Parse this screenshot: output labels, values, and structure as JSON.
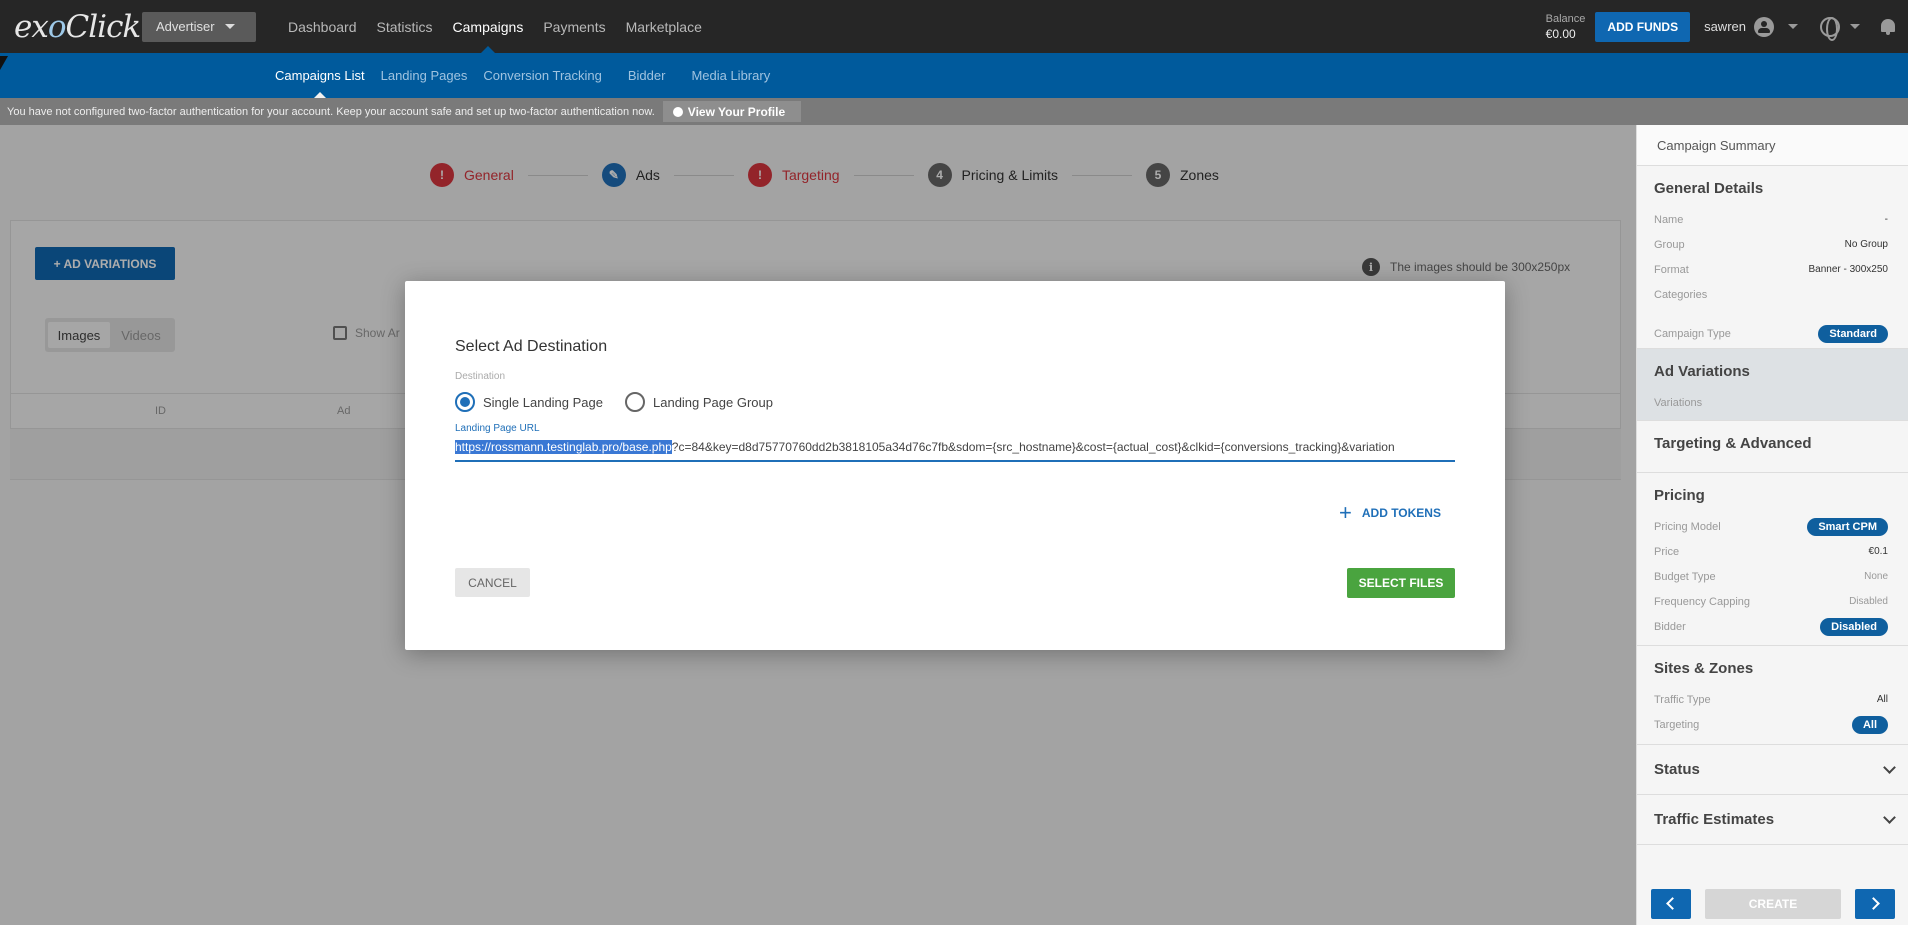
{
  "header": {
    "logo": "exoClick",
    "advertiser_label": "Advertiser",
    "nav": [
      "Dashboard",
      "Statistics",
      "Campaigns",
      "Payments",
      "Marketplace"
    ],
    "active_nav": "Campaigns",
    "balance_label": "Balance",
    "balance_value": "€0.00",
    "add_funds": "ADD FUNDS",
    "username": "sawren"
  },
  "subnav": {
    "items": [
      "Campaigns List",
      "Landing Pages",
      "Conversion Tracking",
      "Bidder",
      "Media Library"
    ],
    "active": "Campaigns List"
  },
  "banner": {
    "text": "You have not configured two-factor authentication for your account. Keep your account safe and set up two-factor authentication now.",
    "button": "View Your Profile"
  },
  "stepper": {
    "steps": [
      {
        "marker": "!",
        "label": "General",
        "state": "error"
      },
      {
        "marker": "✎",
        "label": "Ads",
        "state": "edit"
      },
      {
        "marker": "!",
        "label": "Targeting",
        "state": "error"
      },
      {
        "marker": "4",
        "label": "Pricing & Limits",
        "state": "pending"
      },
      {
        "marker": "5",
        "label": "Zones",
        "state": "pending"
      }
    ]
  },
  "ads": {
    "add_variations": "+ AD VARIATIONS",
    "image_note": "The images should be 300x250px",
    "toggle": [
      "Images",
      "Videos"
    ],
    "toggle_active": "Images",
    "show_checkbox": "Show Ar",
    "columns": [
      "ID",
      "Ad"
    ]
  },
  "modal": {
    "title": "Select Ad Destination",
    "destination_label": "Destination",
    "options": [
      "Single Landing Page",
      "Landing Page Group"
    ],
    "selected_option": "Single Landing Page",
    "url_label": "Landing Page URL",
    "url_selected": "https://rossmann.testinglab.pro/base.php",
    "url_rest": "?c=84&key=d8d75770760dd2b3818105a34d76c7fb&sdom={src_hostname}&cost={actual_cost}&clkid={conversions_tracking}&variation",
    "add_tokens": "ADD TOKENS",
    "cancel": "CANCEL",
    "select_files": "SELECT FILES"
  },
  "summary": {
    "header": "Campaign Summary",
    "general": {
      "title": "General Details",
      "name_label": "Name",
      "name_value": "-",
      "group_label": "Group",
      "group_value": "No Group",
      "format_label": "Format",
      "format_value": "Banner - 300x250",
      "categories_label": "Categories",
      "type_label": "Campaign Type",
      "type_value": "Standard"
    },
    "ad_variations": {
      "title": "Ad Variations",
      "variations_label": "Variations"
    },
    "targeting_title": "Targeting & Advanced",
    "pricing": {
      "title": "Pricing",
      "model_label": "Pricing Model",
      "model_value": "Smart CPM",
      "price_label": "Price",
      "price_value": "€0.1",
      "budget_label": "Budget Type",
      "budget_value": "None",
      "freq_label": "Frequency Capping",
      "freq_value": "Disabled",
      "bidder_label": "Bidder",
      "bidder_value": "Disabled"
    },
    "sites": {
      "title": "Sites & Zones",
      "traffic_label": "Traffic Type",
      "traffic_value": "All",
      "targeting_label": "Targeting",
      "targeting_value": "All"
    },
    "status_title": "Status",
    "traffic_title": "Traffic Estimates",
    "create": "CREATE"
  },
  "colors": {
    "topbar": "#262626",
    "subbar": "#005a9c",
    "accent": "#0f67b1",
    "error": "#d9363e",
    "success": "#4aa43f"
  }
}
